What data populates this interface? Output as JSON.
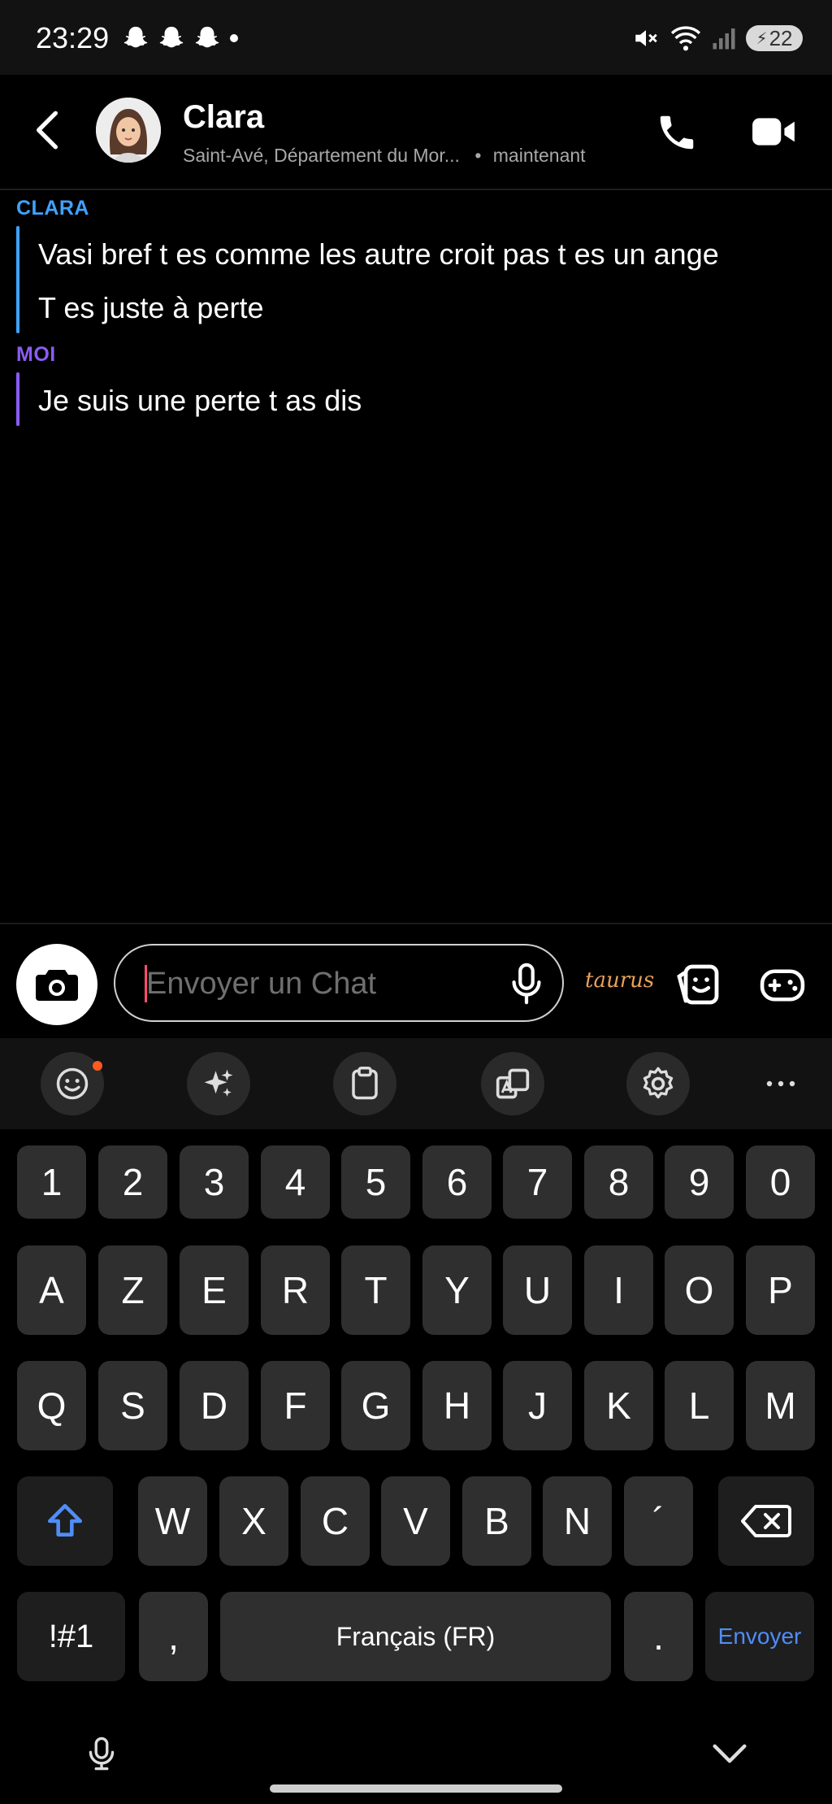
{
  "status_bar": {
    "time": "23:29",
    "notification_icons": [
      "snapchat-ghost-icon",
      "snapchat-ghost-icon",
      "snapchat-ghost-icon"
    ],
    "battery": "22",
    "network_badge": "5"
  },
  "header": {
    "contact_name": "Clara",
    "location": "Saint-Avé, Département du Mor...",
    "separator": "•",
    "last_seen": "maintenant"
  },
  "messages": [
    {
      "sender": "CLARA",
      "color": "#3fa2ff",
      "lines": [
        "Vasi bref t es comme les autre croit pas t es un ange",
        "T es juste à perte"
      ]
    },
    {
      "sender": "MOI",
      "color": "#8a5cf6",
      "lines": [
        "Je suis une perte t as dis"
      ]
    }
  ],
  "composer": {
    "placeholder": "Envoyer un Chat",
    "sticker_text": "taurus"
  },
  "keyboard": {
    "toolbar_icons": [
      "emoji-icon",
      "sparkle-icon",
      "clipboard-icon",
      "translate-icon",
      "settings-icon",
      "more-icon"
    ],
    "row_numbers": [
      "1",
      "2",
      "3",
      "4",
      "5",
      "6",
      "7",
      "8",
      "9",
      "0"
    ],
    "row_1": [
      "A",
      "Z",
      "E",
      "R",
      "T",
      "Y",
      "U",
      "I",
      "O",
      "P"
    ],
    "row_2": [
      "Q",
      "S",
      "D",
      "F",
      "G",
      "H",
      "J",
      "K",
      "L",
      "M"
    ],
    "row_3": [
      "W",
      "X",
      "C",
      "V",
      "B",
      "N",
      "´"
    ],
    "symbols_key": "!#1",
    "comma_key": ",",
    "space_label": "Français (FR)",
    "period_key": ".",
    "send_key": "Envoyer",
    "send_color": "#4f8df7"
  }
}
